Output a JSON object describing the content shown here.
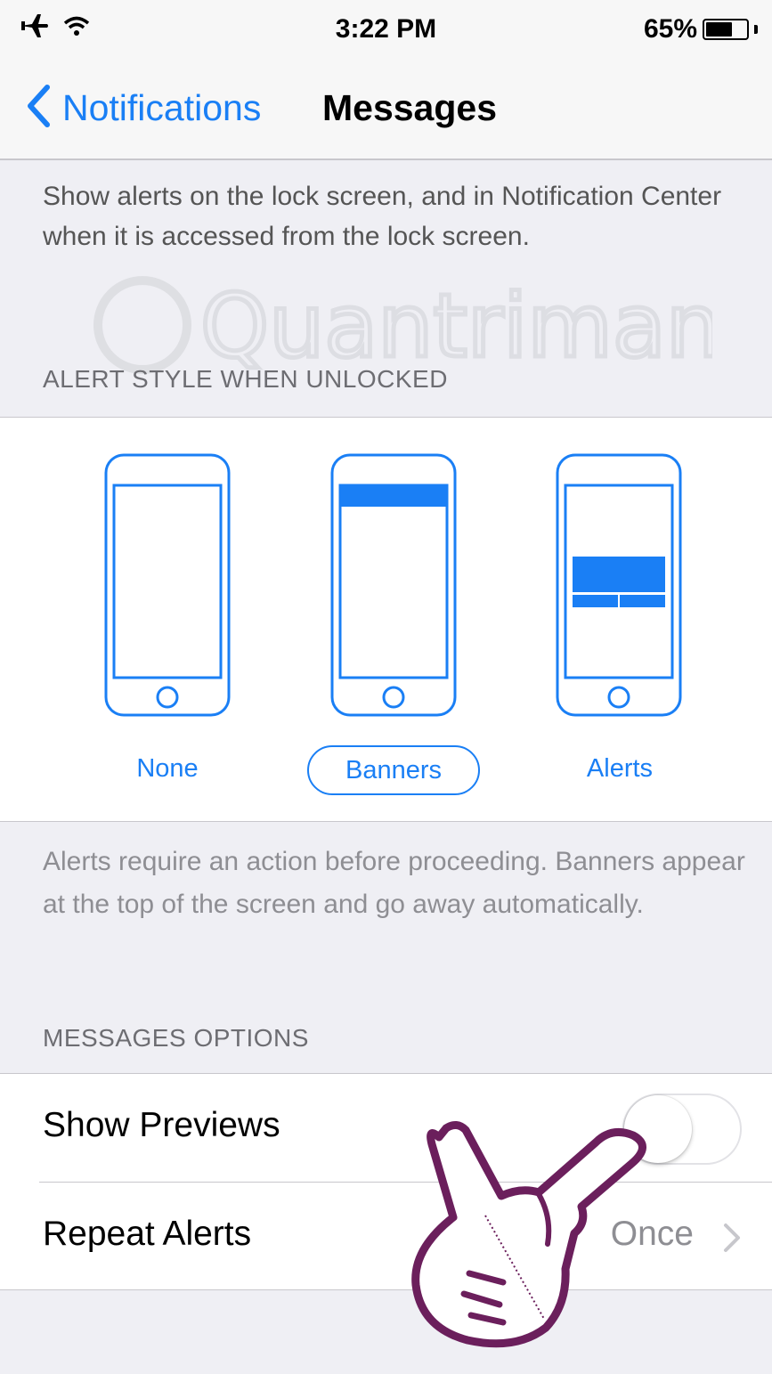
{
  "status_bar": {
    "time": "3:22 PM",
    "battery_percent": "65%",
    "battery_level": 0.65,
    "icons": [
      "airplane-icon",
      "wifi-icon",
      "battery-icon"
    ]
  },
  "nav": {
    "back_label": "Notifications",
    "title": "Messages"
  },
  "lock_screen_description": "Show alerts on the lock screen, and in Notification Center when it is accessed from the lock screen.",
  "alert_style": {
    "header": "ALERT STYLE WHEN UNLOCKED",
    "options": [
      {
        "label": "None",
        "icon": "phone-none-icon",
        "selected": false
      },
      {
        "label": "Banners",
        "icon": "phone-banner-icon",
        "selected": true
      },
      {
        "label": "Alerts",
        "icon": "phone-alert-icon",
        "selected": false
      }
    ],
    "description": "Alerts require an action before proceeding. Banners appear at the top of the screen and go away automatically."
  },
  "messages_options": {
    "header": "MESSAGES OPTIONS",
    "show_previews": {
      "label": "Show Previews",
      "enabled": false
    },
    "repeat_alerts": {
      "label": "Repeat Alerts",
      "value": "Once"
    }
  },
  "watermark": "Quantrimang",
  "colors": {
    "accent": "#1a7ff5",
    "background": "#efeff4",
    "panel": "#ffffff",
    "secondary_text": "#8e8e93",
    "pointer_hand": "#6b1f5c"
  }
}
